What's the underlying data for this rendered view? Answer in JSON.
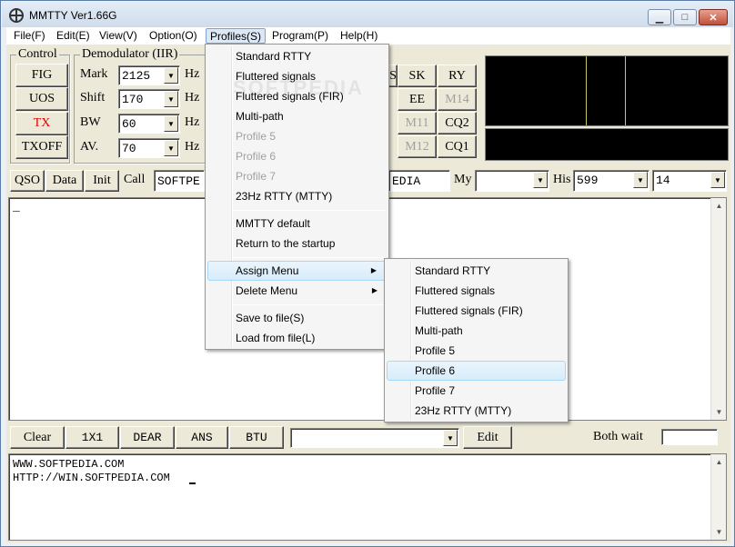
{
  "window": {
    "title": "MMTTY Ver1.66G"
  },
  "titlebar_buttons": {
    "min": "▁",
    "max": "□",
    "close": "✕"
  },
  "menubar": [
    "File(F)",
    "Edit(E)",
    "View(V)",
    "Option(O)",
    "Profiles(S)",
    "Program(P)",
    "Help(H)"
  ],
  "control": {
    "title": "Control",
    "buttons": [
      "FIG",
      "UOS",
      "TX",
      "TXOFF"
    ]
  },
  "demod": {
    "title": "Demodulator (IIR)",
    "rows": [
      {
        "label": "Mark",
        "value": "2125",
        "unit": "Hz"
      },
      {
        "label": "Shift",
        "value": "170",
        "unit": "Hz"
      },
      {
        "label": "BW",
        "value": "60",
        "unit": "Hz"
      },
      {
        "label": "AV.",
        "value": "70",
        "unit": "Hz"
      }
    ]
  },
  "macro_grid": [
    "S",
    "SK",
    "RY",
    "EE",
    "M14",
    "M11",
    "CQ2",
    "M12",
    "CQ1"
  ],
  "qso_bar": {
    "qso": "QSO",
    "data": "Data",
    "init": "Init",
    "call_label": "Call",
    "call_value": "SOFTPE",
    "name_value": "EDIA",
    "my_label": "My",
    "my_value": "",
    "his_label": "His",
    "his_value": "599",
    "last_value": "14"
  },
  "rx_text": "_",
  "macro_bar": {
    "buttons": [
      "Clear",
      "1X1",
      "DEAR",
      "ANS",
      "BTU"
    ],
    "combo_value": "",
    "edit": "Edit",
    "both_wait": "Both wait"
  },
  "tx_lines": [
    "WWW.SOFTPEDIA.COM",
    "HTTP://WIN.SOFTPEDIA.COM"
  ],
  "watermark": "SOFTPEDIA",
  "profiles_menu": {
    "items": [
      {
        "label": "Standard RTTY",
        "enabled": true
      },
      {
        "label": "Fluttered signals",
        "enabled": true
      },
      {
        "label": "Fluttered signals (FIR)",
        "enabled": true
      },
      {
        "label": "Multi-path",
        "enabled": true
      },
      {
        "label": "Profile 5",
        "enabled": false
      },
      {
        "label": "Profile 6",
        "enabled": false
      },
      {
        "label": "Profile 7",
        "enabled": false
      },
      {
        "label": "23Hz RTTY (MTTY)",
        "enabled": true
      },
      {
        "label": "MMTTY default",
        "enabled": true
      },
      {
        "label": "Return to the startup",
        "enabled": true
      },
      {
        "label": "Assign Menu",
        "enabled": true
      },
      {
        "label": "Delete Menu",
        "enabled": true
      },
      {
        "label": "Save to file(S)",
        "enabled": true
      },
      {
        "label": "Load from file(L)",
        "enabled": true
      }
    ],
    "submenu_arrow": "▶"
  },
  "assign_submenu": [
    "Standard RTTY",
    "Fluttered signals",
    "Fluttered signals (FIR)",
    "Multi-path",
    "Profile 5",
    "Profile 6",
    "Profile 7",
    "23Hz RTTY (MTTY)"
  ],
  "colors": {
    "tx_red": "#e00000",
    "highlight": "#d7ecfb",
    "scope_bg": "#000000",
    "scope_line": "#c8c864"
  }
}
